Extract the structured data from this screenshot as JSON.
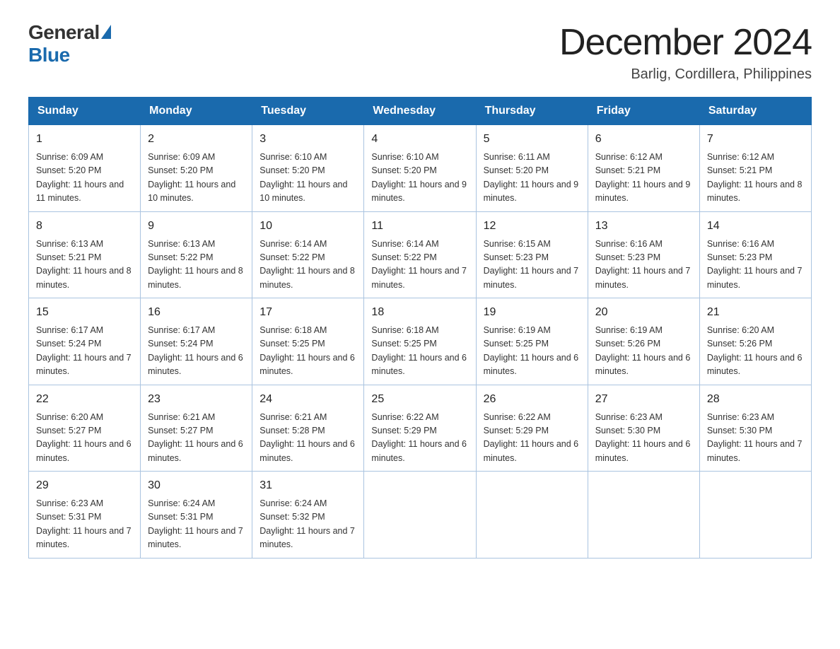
{
  "header": {
    "logo_general": "General",
    "logo_blue": "Blue",
    "month_title": "December 2024",
    "location": "Barlig, Cordillera, Philippines"
  },
  "weekdays": [
    "Sunday",
    "Monday",
    "Tuesday",
    "Wednesday",
    "Thursday",
    "Friday",
    "Saturday"
  ],
  "weeks": [
    [
      {
        "day": "1",
        "sunrise": "6:09 AM",
        "sunset": "5:20 PM",
        "daylight": "11 hours and 11 minutes."
      },
      {
        "day": "2",
        "sunrise": "6:09 AM",
        "sunset": "5:20 PM",
        "daylight": "11 hours and 10 minutes."
      },
      {
        "day": "3",
        "sunrise": "6:10 AM",
        "sunset": "5:20 PM",
        "daylight": "11 hours and 10 minutes."
      },
      {
        "day": "4",
        "sunrise": "6:10 AM",
        "sunset": "5:20 PM",
        "daylight": "11 hours and 9 minutes."
      },
      {
        "day": "5",
        "sunrise": "6:11 AM",
        "sunset": "5:20 PM",
        "daylight": "11 hours and 9 minutes."
      },
      {
        "day": "6",
        "sunrise": "6:12 AM",
        "sunset": "5:21 PM",
        "daylight": "11 hours and 9 minutes."
      },
      {
        "day": "7",
        "sunrise": "6:12 AM",
        "sunset": "5:21 PM",
        "daylight": "11 hours and 8 minutes."
      }
    ],
    [
      {
        "day": "8",
        "sunrise": "6:13 AM",
        "sunset": "5:21 PM",
        "daylight": "11 hours and 8 minutes."
      },
      {
        "day": "9",
        "sunrise": "6:13 AM",
        "sunset": "5:22 PM",
        "daylight": "11 hours and 8 minutes."
      },
      {
        "day": "10",
        "sunrise": "6:14 AM",
        "sunset": "5:22 PM",
        "daylight": "11 hours and 8 minutes."
      },
      {
        "day": "11",
        "sunrise": "6:14 AM",
        "sunset": "5:22 PM",
        "daylight": "11 hours and 7 minutes."
      },
      {
        "day": "12",
        "sunrise": "6:15 AM",
        "sunset": "5:23 PM",
        "daylight": "11 hours and 7 minutes."
      },
      {
        "day": "13",
        "sunrise": "6:16 AM",
        "sunset": "5:23 PM",
        "daylight": "11 hours and 7 minutes."
      },
      {
        "day": "14",
        "sunrise": "6:16 AM",
        "sunset": "5:23 PM",
        "daylight": "11 hours and 7 minutes."
      }
    ],
    [
      {
        "day": "15",
        "sunrise": "6:17 AM",
        "sunset": "5:24 PM",
        "daylight": "11 hours and 7 minutes."
      },
      {
        "day": "16",
        "sunrise": "6:17 AM",
        "sunset": "5:24 PM",
        "daylight": "11 hours and 6 minutes."
      },
      {
        "day": "17",
        "sunrise": "6:18 AM",
        "sunset": "5:25 PM",
        "daylight": "11 hours and 6 minutes."
      },
      {
        "day": "18",
        "sunrise": "6:18 AM",
        "sunset": "5:25 PM",
        "daylight": "11 hours and 6 minutes."
      },
      {
        "day": "19",
        "sunrise": "6:19 AM",
        "sunset": "5:25 PM",
        "daylight": "11 hours and 6 minutes."
      },
      {
        "day": "20",
        "sunrise": "6:19 AM",
        "sunset": "5:26 PM",
        "daylight": "11 hours and 6 minutes."
      },
      {
        "day": "21",
        "sunrise": "6:20 AM",
        "sunset": "5:26 PM",
        "daylight": "11 hours and 6 minutes."
      }
    ],
    [
      {
        "day": "22",
        "sunrise": "6:20 AM",
        "sunset": "5:27 PM",
        "daylight": "11 hours and 6 minutes."
      },
      {
        "day": "23",
        "sunrise": "6:21 AM",
        "sunset": "5:27 PM",
        "daylight": "11 hours and 6 minutes."
      },
      {
        "day": "24",
        "sunrise": "6:21 AM",
        "sunset": "5:28 PM",
        "daylight": "11 hours and 6 minutes."
      },
      {
        "day": "25",
        "sunrise": "6:22 AM",
        "sunset": "5:29 PM",
        "daylight": "11 hours and 6 minutes."
      },
      {
        "day": "26",
        "sunrise": "6:22 AM",
        "sunset": "5:29 PM",
        "daylight": "11 hours and 6 minutes."
      },
      {
        "day": "27",
        "sunrise": "6:23 AM",
        "sunset": "5:30 PM",
        "daylight": "11 hours and 6 minutes."
      },
      {
        "day": "28",
        "sunrise": "6:23 AM",
        "sunset": "5:30 PM",
        "daylight": "11 hours and 7 minutes."
      }
    ],
    [
      {
        "day": "29",
        "sunrise": "6:23 AM",
        "sunset": "5:31 PM",
        "daylight": "11 hours and 7 minutes."
      },
      {
        "day": "30",
        "sunrise": "6:24 AM",
        "sunset": "5:31 PM",
        "daylight": "11 hours and 7 minutes."
      },
      {
        "day": "31",
        "sunrise": "6:24 AM",
        "sunset": "5:32 PM",
        "daylight": "11 hours and 7 minutes."
      },
      null,
      null,
      null,
      null
    ]
  ]
}
